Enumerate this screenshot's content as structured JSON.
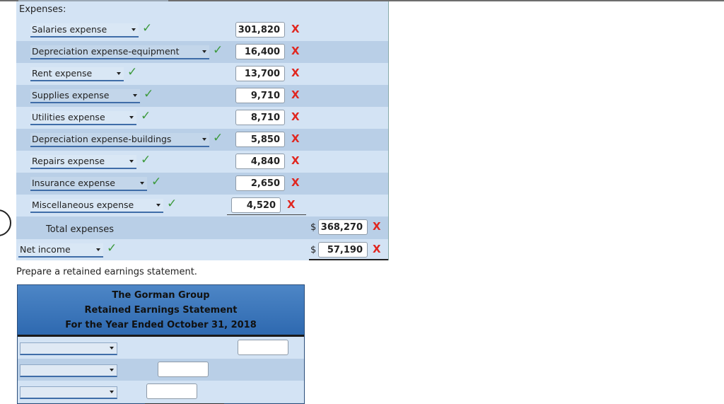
{
  "expenses": {
    "section_label": "Expenses:",
    "items": [
      {
        "label": "Salaries expense",
        "amount": "301,820"
      },
      {
        "label": "Depreciation expense-equipment",
        "amount": "16,400"
      },
      {
        "label": "Rent expense",
        "amount": "13,700"
      },
      {
        "label": "Supplies expense",
        "amount": "9,710"
      },
      {
        "label": "Utilities expense",
        "amount": "8,710"
      },
      {
        "label": "Depreciation expense-buildings",
        "amount": "5,850"
      },
      {
        "label": "Repairs expense",
        "amount": "4,840"
      },
      {
        "label": "Insurance expense",
        "amount": "2,650"
      },
      {
        "label": "Miscellaneous expense",
        "amount": "4,520"
      }
    ],
    "total_label": "Total expenses",
    "total_currency": "$",
    "total_amount": "368,270"
  },
  "net_income": {
    "label": "Net income",
    "currency": "$",
    "amount": "57,190"
  },
  "marks": {
    "check": "✓",
    "cross": "X"
  },
  "prompt": "Prepare a retained earnings statement.",
  "statement": {
    "company": "The Gorman Group",
    "title": "Retained Earnings Statement",
    "period": "For the Year Ended October 31, 2018"
  },
  "colors": {
    "header_blue": "#3a76bb",
    "row_light": "#d3e3f4",
    "row_dark": "#b9cfe7",
    "check_green": "#3d9a3d",
    "cross_red": "#e0261f"
  }
}
